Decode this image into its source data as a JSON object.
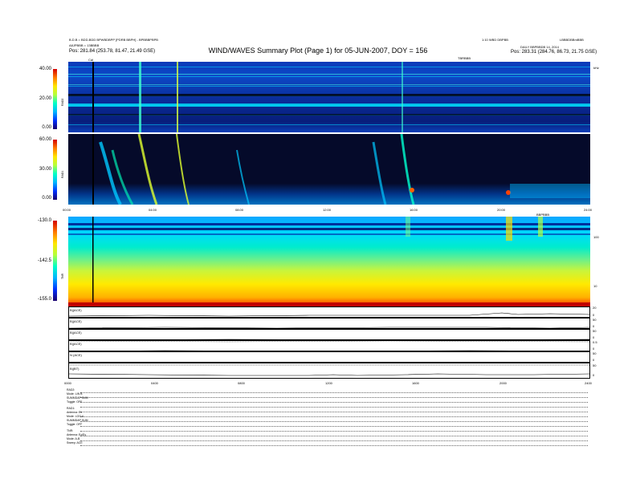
{
  "header": {
    "left_line1": "B.D.B = BDD-BDD BPWBDBPP [PDRB BBPH] - BPBBBPBPB",
    "left_line2": "A8JPBBB = 13BBBB",
    "left_pos": "Pos:   281.84 (253.78, 81.47, 21.49 GSE)",
    "title": "WIND/WAVES Summary Plot (Page 1) for 05-JUN-2007, DOY = 156",
    "center_right": "1:10 WBD DBPBB",
    "right_top": "LBBBDBBmBBB",
    "right_line2": "DAILY BBPBBDB 14, 2014",
    "right_pos": "Pos:   283.31 (284.76, 86.73, 21.75 GSE)",
    "marker_label": "Cal",
    "tbr_label": "TBRBBB",
    "tnr_right_label": "BBPBBB",
    "right_unit": "kHz"
  },
  "chart_data": [
    {
      "type": "heatmap",
      "name": "RAD2",
      "ylabel": "RAD2",
      "yticks": [
        "40.0",
        "20.0",
        "0.0"
      ],
      "colorbar": [
        "0.00",
        "20.00",
        "40.00"
      ]
    },
    {
      "type": "heatmap",
      "name": "RAD1",
      "ylabel": "RAD1",
      "yticks": [
        "60.0",
        "30.0",
        "0.0"
      ],
      "colorbar": [
        "0.00",
        "30.00",
        "60.00"
      ],
      "x_ticks": [
        "00:00",
        "04:00",
        "08:00",
        "12:00",
        "16:00",
        "20:00",
        "24:00"
      ]
    },
    {
      "type": "heatmap",
      "name": "TNR",
      "ylabel": "TNR",
      "yticks": [
        "-130.0",
        "-142.5",
        "-155.0"
      ],
      "right_ticks": [
        "100",
        "10"
      ]
    },
    {
      "type": "line",
      "name": "Magnetic field",
      "panels": [
        {
          "label": "B|(ACE)",
          "right": [
            "20",
            "0"
          ]
        },
        {
          "label": "B|(ACE)",
          "right": [
            "50",
            "0"
          ]
        },
        {
          "label": "B|(ACE)",
          "right": [
            "50",
            "0"
          ]
        },
        {
          "label": "B|(ACE)",
          "right": [
            "0.5",
            "0"
          ]
        },
        {
          "label": "N (ACE)",
          "right": [
            "50",
            "0"
          ]
        },
        {
          "label": "B|(BT)",
          "right": [
            "50",
            "0"
          ]
        }
      ],
      "x_ticks": [
        "0000",
        "0400",
        "0800",
        "1200",
        "1600",
        "2000",
        "2400"
      ]
    }
  ],
  "key": {
    "rows": [
      "RAD2:",
      "Mode:  LIN B",
      "SUMMDAP  SUM",
      "Toggle:  OFF",
      "RAD1:",
      "Antenna:   Ex",
      "Mode:  LOG A",
      "SUMMDAP SUM",
      "Toggle:  OFF",
      "TNR:",
      "Antenna:  Ex/Ey",
      "Mode:   A-B",
      "Sweep:   ACE"
    ]
  }
}
